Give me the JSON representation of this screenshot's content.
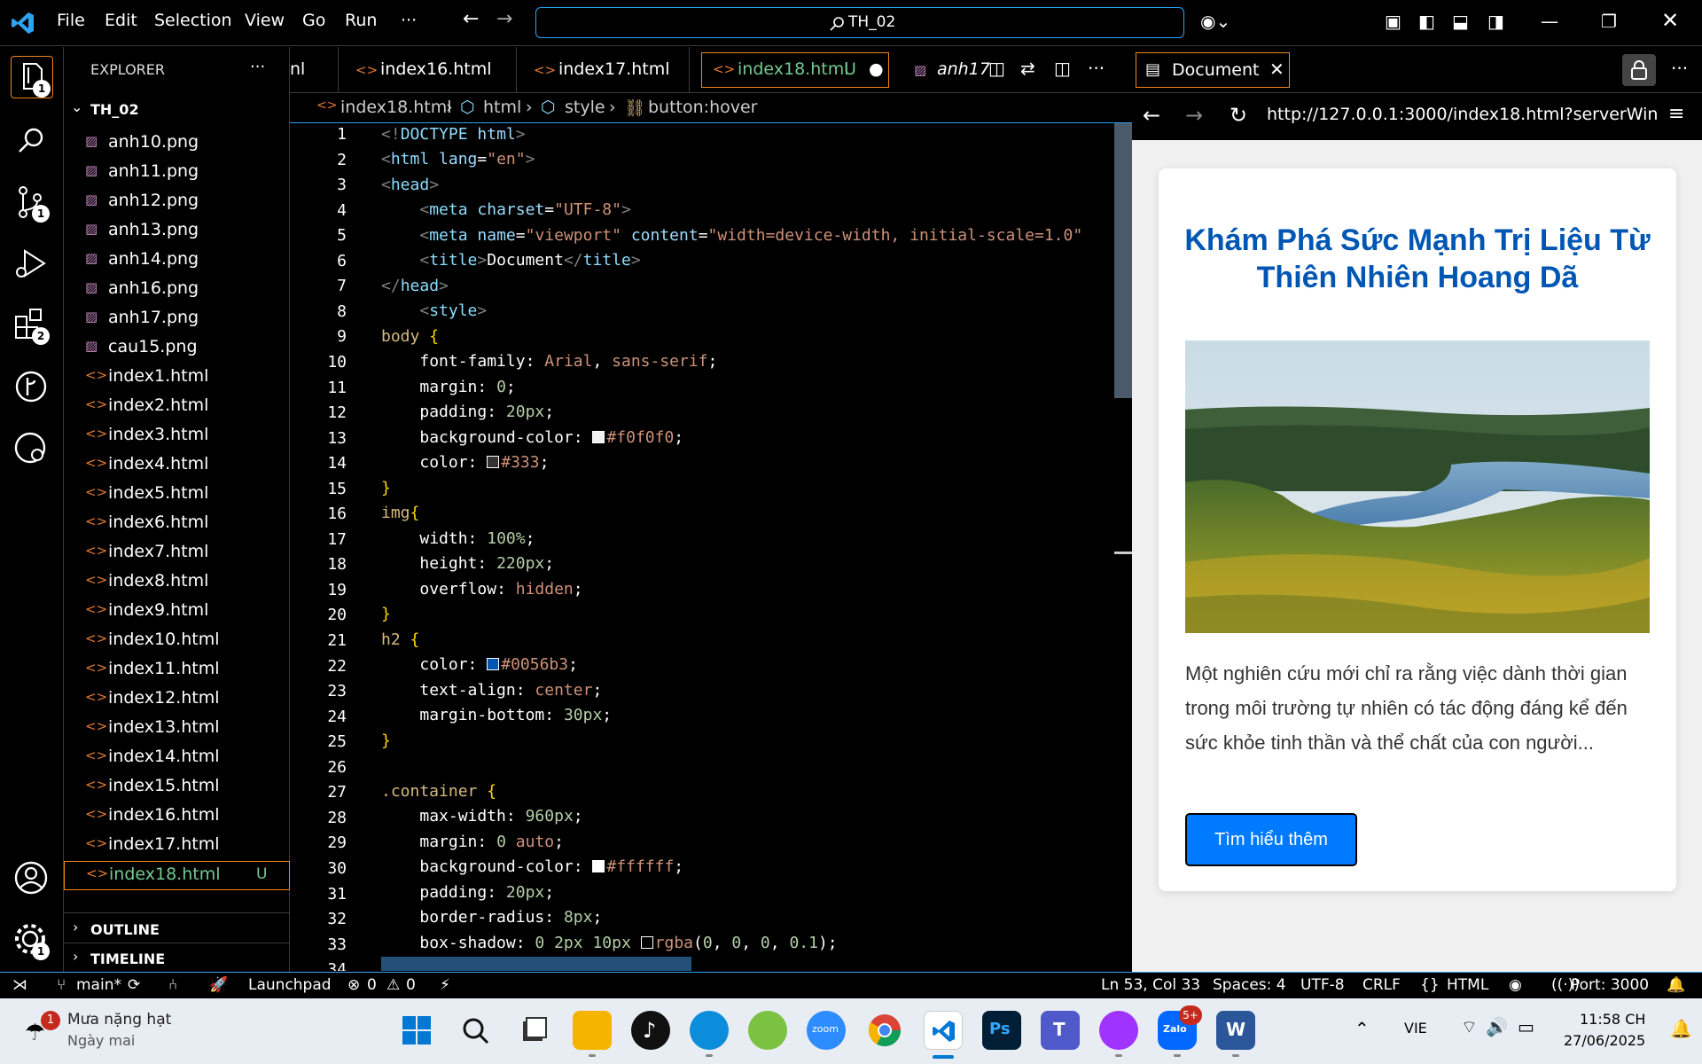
{
  "window": {
    "menu": [
      "File",
      "Edit",
      "Selection",
      "View",
      "Go",
      "Run",
      "···"
    ],
    "search": "TH_02"
  },
  "activity": {
    "explorer_badge": "1",
    "scm_badge": "1",
    "extensions_badge": "2",
    "settings_badge": "1"
  },
  "explorer": {
    "title": "EXPLORER",
    "more": "···",
    "folder": "TH_02",
    "files": [
      {
        "name": "anh10.png",
        "type": "png"
      },
      {
        "name": "anh11.png",
        "type": "png"
      },
      {
        "name": "anh12.png",
        "type": "png"
      },
      {
        "name": "anh13.png",
        "type": "png"
      },
      {
        "name": "anh14.png",
        "type": "png"
      },
      {
        "name": "anh16.png",
        "type": "png"
      },
      {
        "name": "anh17.png",
        "type": "png"
      },
      {
        "name": "cau15.png",
        "type": "png"
      },
      {
        "name": "index1.html",
        "type": "html"
      },
      {
        "name": "index2.html",
        "type": "html"
      },
      {
        "name": "index3.html",
        "type": "html"
      },
      {
        "name": "index4.html",
        "type": "html"
      },
      {
        "name": "index5.html",
        "type": "html"
      },
      {
        "name": "index6.html",
        "type": "html"
      },
      {
        "name": "index7.html",
        "type": "html"
      },
      {
        "name": "index8.html",
        "type": "html"
      },
      {
        "name": "index9.html",
        "type": "html"
      },
      {
        "name": "index10.html",
        "type": "html"
      },
      {
        "name": "index11.html",
        "type": "html"
      },
      {
        "name": "index12.html",
        "type": "html"
      },
      {
        "name": "index13.html",
        "type": "html"
      },
      {
        "name": "index14.html",
        "type": "html"
      },
      {
        "name": "index15.html",
        "type": "html"
      },
      {
        "name": "index16.html",
        "type": "html"
      },
      {
        "name": "index17.html",
        "type": "html"
      },
      {
        "name": "index18.html",
        "type": "html",
        "status": "U"
      }
    ],
    "outline": "OUTLINE",
    "timeline": "TIMELINE"
  },
  "tabs": [
    {
      "label": "nl"
    },
    {
      "label": "index16.html"
    },
    {
      "label": "index17.html"
    },
    {
      "label": "index18.html",
      "status": "U"
    },
    {
      "label": "anh17"
    }
  ],
  "breadcrumb": [
    "index18.html",
    "html",
    "style",
    "button:hover"
  ],
  "editor": {
    "line_numbers": [
      "1",
      "2",
      "3",
      "4",
      "5",
      "6",
      "7",
      "8",
      "9",
      "10",
      "11",
      "12",
      "13",
      "14",
      "15",
      "16",
      "17",
      "18",
      "19",
      "20",
      "21",
      "22",
      "23",
      "24",
      "25",
      "26",
      "27",
      "28",
      "29",
      "30",
      "31",
      "32",
      "33",
      "34"
    ]
  },
  "browser": {
    "tab_title": "Document",
    "url": "http://127.0.0.1:3000/index18.html?serverWindow",
    "heading": "Khám Phá Sức Mạnh Trị Liệu Từ Thiên Nhiên Hoang Dã",
    "body": "Một nghiên cứu mới chỉ ra rằng việc dành thời gian trong môi trường tự nhiên có tác động đáng kể đến sức khỏe tinh thần và thể chất của con người...",
    "button": "Tìm hiểu thêm"
  },
  "status": {
    "branch": "main*",
    "launchpad": "Launchpad",
    "errors": "0",
    "warnings": "0",
    "position": "Ln 53, Col 33",
    "spaces": "Spaces: 4",
    "encoding": "UTF-8",
    "eol": "CRLF",
    "language": "HTML",
    "port": "Port: 3000"
  },
  "taskbar": {
    "weather_title": "Mưa nặng hạt",
    "weather_sub": "Ngày mai",
    "weather_badge": "1",
    "zalo_badge": "5+",
    "lang": "VIE",
    "time": "11:58 CH",
    "date": "27/06/2025"
  },
  "colors": {
    "accent": "#2ea3f2",
    "active_border": "#f38518",
    "heading": "#0056b3",
    "button": "#007bff"
  }
}
